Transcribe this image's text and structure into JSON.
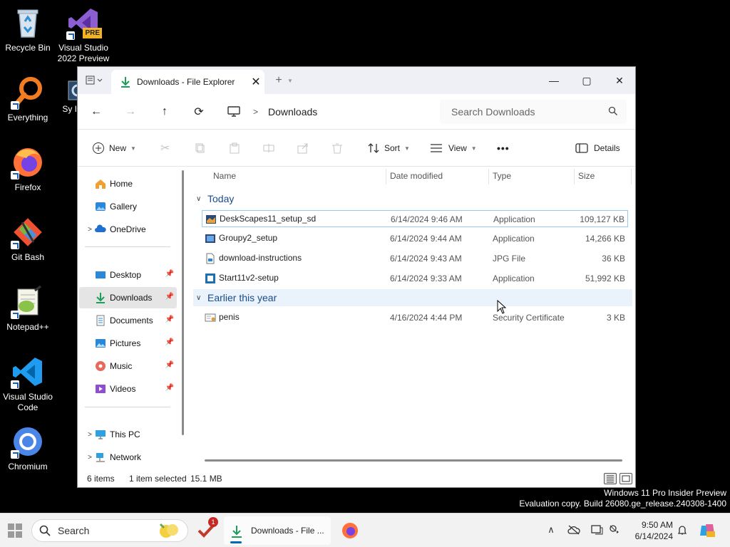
{
  "desktop": {
    "icons": [
      {
        "label": "Recycle Bin",
        "icon": "recycle-bin-icon"
      },
      {
        "label": "Visual Studio 2022 Preview",
        "icon": "visual-studio-icon",
        "badge": "PRE"
      },
      {
        "label": "Everything",
        "icon": "everything-search-icon"
      },
      {
        "label": "Firefox",
        "icon": "firefox-icon"
      },
      {
        "label": "Git Bash",
        "icon": "git-bash-icon"
      },
      {
        "label": "Notepad++",
        "icon": "notepad-plus-plus-icon"
      },
      {
        "label": "Visual Studio Code",
        "icon": "vscode-icon"
      },
      {
        "label": "Chromium",
        "icon": "chromium-icon"
      },
      {
        "label": "Sy Inf",
        "icon": "system-information-icon"
      }
    ]
  },
  "window": {
    "tab_title": "Downloads - File Explorer",
    "titlebar": {
      "new_tab": "+",
      "minimize": "—",
      "maximize": "▢",
      "close": "✕"
    },
    "nav": {
      "back": "←",
      "forward": "→",
      "up": "↑",
      "refresh": "⟳"
    },
    "breadcrumb": {
      "separator": ">",
      "current": "Downloads"
    },
    "search_placeholder": "Search Downloads",
    "toolbar": {
      "new": "New",
      "sort": "Sort",
      "view": "View",
      "more": "•••",
      "details": "Details"
    },
    "sidebar": {
      "items": [
        {
          "label": "Home",
          "icon": "home-icon"
        },
        {
          "label": "Gallery",
          "icon": "gallery-icon"
        },
        {
          "label": "OneDrive",
          "icon": "onedrive-icon"
        },
        {
          "label": "Desktop",
          "icon": "desktop-folder-icon"
        },
        {
          "label": "Downloads",
          "icon": "downloads-folder-icon"
        },
        {
          "label": "Documents",
          "icon": "documents-folder-icon"
        },
        {
          "label": "Pictures",
          "icon": "pictures-folder-icon"
        },
        {
          "label": "Music",
          "icon": "music-folder-icon"
        },
        {
          "label": "Videos",
          "icon": "videos-folder-icon"
        },
        {
          "label": "This PC",
          "icon": "this-pc-icon"
        },
        {
          "label": "Network",
          "icon": "network-icon"
        }
      ]
    },
    "columns": {
      "name": "Name",
      "date": "Date modified",
      "type": "Type",
      "size": "Size"
    },
    "groups": [
      {
        "label": "Today"
      },
      {
        "label": "Earlier this year"
      }
    ],
    "files": [
      {
        "name": "DeskScapes11_setup_sd",
        "date": "6/14/2024 9:46 AM",
        "type": "Application",
        "size": "109,127 KB",
        "icon": "installer-icon"
      },
      {
        "name": "Groupy2_setup",
        "date": "6/14/2024 9:44 AM",
        "type": "Application",
        "size": "14,266 KB",
        "icon": "installer-icon"
      },
      {
        "name": "download-instructions",
        "date": "6/14/2024 9:43 AM",
        "type": "JPG File",
        "size": "36 KB",
        "icon": "image-file-icon"
      },
      {
        "name": "Start11v2-setup",
        "date": "6/14/2024 9:33 AM",
        "type": "Application",
        "size": "51,992 KB",
        "icon": "installer-icon"
      },
      {
        "name": "penis",
        "date": "4/16/2024 4:44 PM",
        "type": "Security Certificate",
        "size": "3 KB",
        "icon": "certificate-icon"
      }
    ],
    "status": {
      "count": "6 items",
      "selected": "1 item selected",
      "size": "15.1 MB"
    }
  },
  "watermark": {
    "line1": "Windows 11 Pro Insider Preview",
    "line2": "Evaluation copy. Build 26080.ge_release.240308-1400"
  },
  "taskbar": {
    "search_label": "Search",
    "explorer_label": "Downloads - File ...",
    "notification_badge": "1",
    "time": "9:50 AM",
    "date": "6/14/2024"
  },
  "colors": {
    "accent": "#0067c0",
    "selection": "#e5e5e5",
    "group_heading": "#1a4c8a"
  }
}
